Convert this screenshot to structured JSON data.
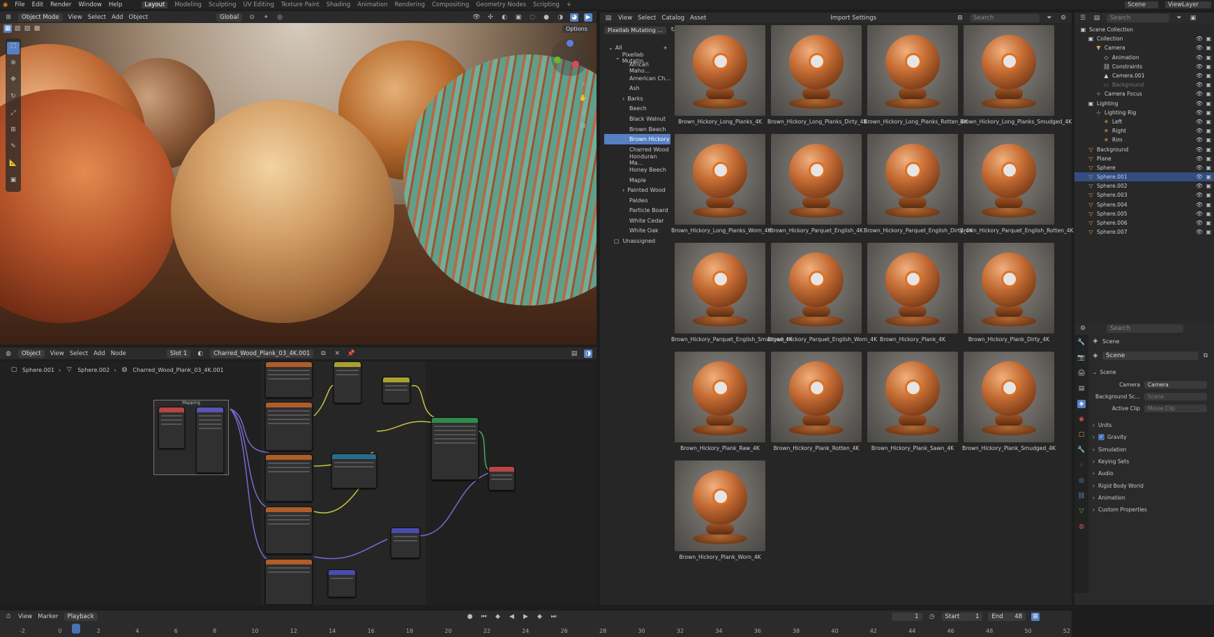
{
  "menu": {
    "items": [
      "File",
      "Edit",
      "Render",
      "Window",
      "Help"
    ],
    "workspaces": [
      "Layout",
      "Modeling",
      "Sculpting",
      "UV Editing",
      "Texture Paint",
      "Shading",
      "Animation",
      "Rendering",
      "Compositing",
      "Geometry Nodes",
      "Scripting"
    ],
    "active_workspace": "Layout",
    "scene": "Scene",
    "view_layer": "ViewLayer"
  },
  "viewport": {
    "mode": "Object Mode",
    "menus": [
      "View",
      "Select",
      "Add",
      "Object"
    ],
    "orientation": "Global",
    "options": "Options"
  },
  "node_editor": {
    "mode": "Object",
    "menus": [
      "View",
      "Select",
      "Add",
      "Node"
    ],
    "slot": "Slot 1",
    "material": "Charred_Wood_Plank_03_4K.001",
    "breadcrumb": [
      "Sphere.001",
      "Sphere.002",
      "Charred_Wood_Plank_03_4K.001"
    ],
    "mapping_frame": "Mapping"
  },
  "asset_browser": {
    "menus": [
      "View",
      "Select",
      "Catalog",
      "Asset"
    ],
    "import_settings": "Import Settings",
    "search_placeholder": "Search",
    "library": "Pixellab Mutating ...",
    "root": "All",
    "library_node": "Pixellab Mutatin...",
    "catalogs": [
      {
        "label": "African Maho...",
        "expandable": false
      },
      {
        "label": "American Ch...",
        "expandable": false
      },
      {
        "label": "Ash",
        "expandable": false
      },
      {
        "label": "Barks",
        "expandable": true
      },
      {
        "label": "Beech",
        "expandable": false
      },
      {
        "label": "Black Walnut",
        "expandable": false
      },
      {
        "label": "Brown Beech",
        "expandable": false
      },
      {
        "label": "Brown Hickory",
        "expandable": false,
        "selected": true
      },
      {
        "label": "Charred Wood",
        "expandable": false
      },
      {
        "label": "Honduran Ma...",
        "expandable": false
      },
      {
        "label": "Honey Beech",
        "expandable": false
      },
      {
        "label": "Maple",
        "expandable": false
      },
      {
        "label": "Painted Wood",
        "expandable": true
      },
      {
        "label": "Paldeo",
        "expandable": false
      },
      {
        "label": "Particle Board",
        "expandable": false
      },
      {
        "label": "White Cedar",
        "expandable": false
      },
      {
        "label": "White Oak",
        "expandable": false
      }
    ],
    "unassigned": "Unassigned",
    "assets": [
      "Brown_Hickory_Long_Planks_4K",
      "Brown_Hickory_Long_Planks_Dirty_4K",
      "Brown_Hickory_Long_Planks_Rotten_4K",
      "Brown_Hickory_Long_Planks_Smudged_4K",
      "Brown_Hickory_Long_Planks_Worn_4K",
      "Brown_Hickory_Parquet_English_4K",
      "Brown_Hickory_Parquet_English_Dirty_4K",
      "Brown_Hickory_Parquet_English_Rotten_4K",
      "Brown_Hickory_Parquet_English_Smudged_4K",
      "Brown_Hickory_Parquet_English_Worn_4K",
      "Brown_Hickory_Plank_4K",
      "Brown_Hickory_Plank_Dirty_4K",
      "Brown_Hickory_Plank_Raw_4K",
      "Brown_Hickory_Plank_Rotten_4K",
      "Brown_Hickory_Plank_Sawn_4K",
      "Brown_Hickory_Plank_Smudged_4K",
      "Brown_Hickory_Plank_Worn_4K"
    ]
  },
  "outliner": {
    "search_placeholder": "Search",
    "items": [
      {
        "label": "Scene Collection",
        "indent": 0,
        "icon": "collection-icon",
        "color": "#cfcfcf"
      },
      {
        "label": "Collection",
        "indent": 1,
        "icon": "collection-icon",
        "color": "#cfcfcf"
      },
      {
        "label": "Camera",
        "indent": 2,
        "icon": "camera-icon",
        "color": "#e0a050"
      },
      {
        "label": "Animation",
        "indent": 3,
        "icon": "animation-icon",
        "color": "#cfcfcf"
      },
      {
        "label": "Constraints",
        "indent": 3,
        "icon": "constraint-icon",
        "color": "#cfcfcf"
      },
      {
        "label": "Camera.001",
        "indent": 3,
        "icon": "camera-data-icon",
        "color": "#cfcfcf"
      },
      {
        "label": "Background",
        "indent": 3,
        "icon": "image-icon",
        "color": "#777777"
      },
      {
        "label": "Camera Focus",
        "indent": 2,
        "icon": "empty-icon",
        "color": "#e0a050"
      },
      {
        "label": "Lighting",
        "indent": 1,
        "icon": "collection-icon",
        "color": "#cfcfcf"
      },
      {
        "label": "Lighting Rig",
        "indent": 2,
        "icon": "empty-icon",
        "color": "#e0a050"
      },
      {
        "label": "Left",
        "indent": 3,
        "icon": "light-icon",
        "color": "#e0a050"
      },
      {
        "label": "Right",
        "indent": 3,
        "icon": "light-icon",
        "color": "#e0a050"
      },
      {
        "label": "Rim",
        "indent": 3,
        "icon": "light-icon",
        "color": "#e0a050"
      },
      {
        "label": "Background",
        "indent": 1,
        "icon": "mesh-icon",
        "color": "#e0a050"
      },
      {
        "label": "Plane",
        "indent": 1,
        "icon": "mesh-icon",
        "color": "#e0a050"
      },
      {
        "label": "Sphere",
        "indent": 1,
        "icon": "mesh-icon",
        "color": "#e0a050"
      },
      {
        "label": "Sphere.001",
        "indent": 1,
        "icon": "mesh-icon",
        "color": "#e0a050",
        "selected": true
      },
      {
        "label": "Sphere.002",
        "indent": 1,
        "icon": "mesh-icon",
        "color": "#e0a050"
      },
      {
        "label": "Sphere.003",
        "indent": 1,
        "icon": "mesh-icon",
        "color": "#e0a050"
      },
      {
        "label": "Sphere.004",
        "indent": 1,
        "icon": "mesh-icon",
        "color": "#e0a050"
      },
      {
        "label": "Sphere.005",
        "indent": 1,
        "icon": "mesh-icon",
        "color": "#e0a050"
      },
      {
        "label": "Sphere.006",
        "indent": 1,
        "icon": "mesh-icon",
        "color": "#e0a050"
      },
      {
        "label": "Sphere.007",
        "indent": 1,
        "icon": "mesh-icon",
        "color": "#e0a050"
      }
    ]
  },
  "properties": {
    "search_placeholder": "Search",
    "context": "Scene",
    "scene_name": "Scene",
    "panel": "Scene",
    "camera_label": "Camera",
    "camera_value": "Camera",
    "bgscene_label": "Background Sc...",
    "bgscene_placeholder": "Scene",
    "clip_label": "Active Clip",
    "clip_placeholder": "Movie Clip",
    "sections": [
      "Units",
      "Gravity",
      "Simulation",
      "Keying Sets",
      "Audio",
      "Rigid Body World",
      "Animation",
      "Custom Properties"
    ]
  },
  "timeline": {
    "menus": [
      "View",
      "Marker",
      "Playback"
    ],
    "current_frame": "1",
    "start_label": "Start",
    "start": "1",
    "end_label": "End",
    "end": "48",
    "ticks": [
      "-2",
      "0",
      "2",
      "4",
      "6",
      "8",
      "10",
      "12",
      "14",
      "16",
      "18",
      "20",
      "22",
      "24",
      "26",
      "28",
      "30",
      "32",
      "34",
      "36",
      "38",
      "40",
      "42",
      "44",
      "46",
      "48",
      "50",
      "52"
    ]
  },
  "colors": {
    "accent": "#5680c2",
    "selected_row": "#334d80",
    "object_orange": "#e0a050"
  }
}
